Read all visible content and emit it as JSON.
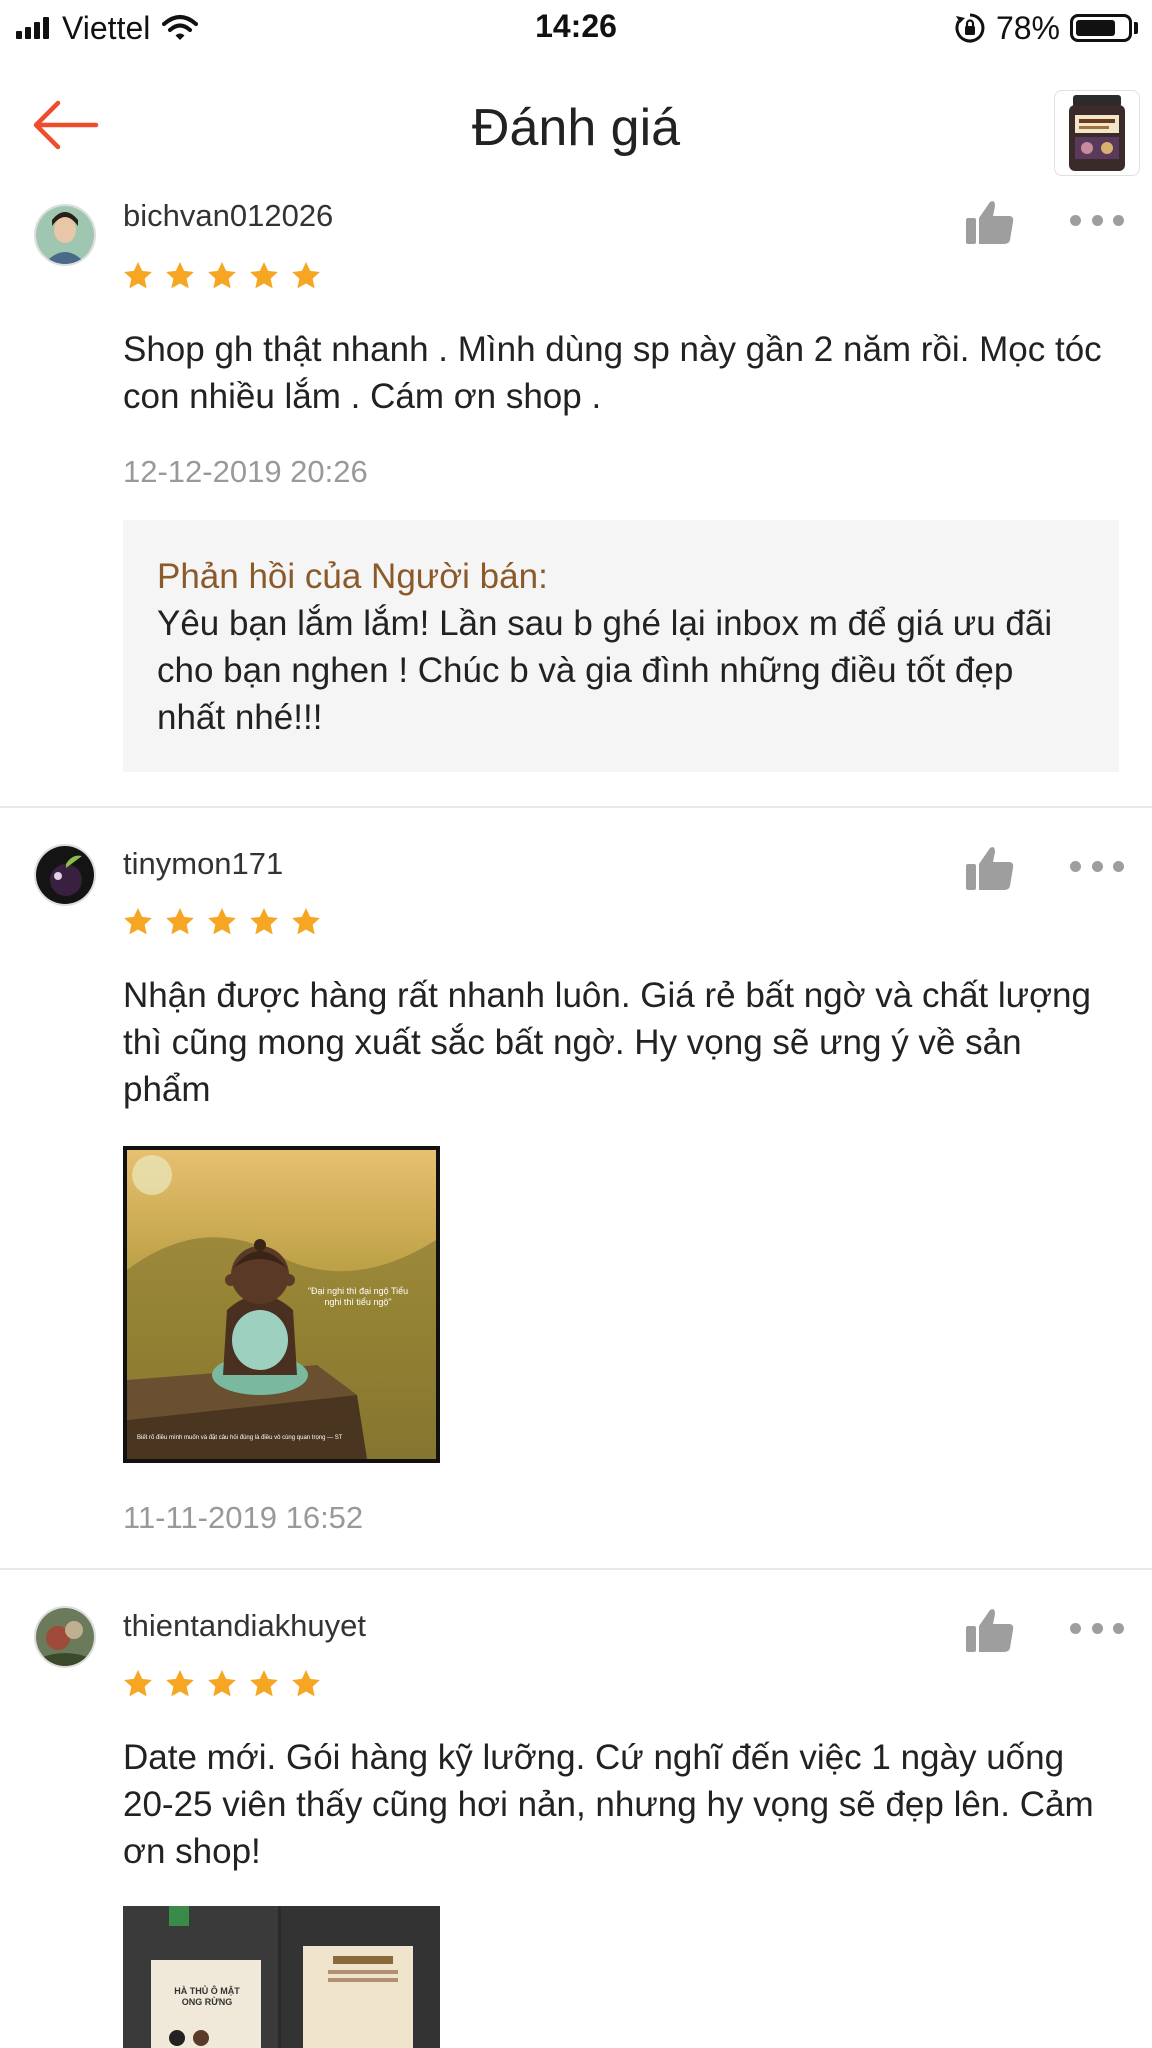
{
  "status_bar": {
    "carrier": "Viettel",
    "time": "14:26",
    "battery_percent": "78%",
    "battery_level": 0.78,
    "icons": [
      "signal-icon",
      "wifi-icon",
      "rotation-lock-icon",
      "battery-icon"
    ]
  },
  "header": {
    "back_icon": "arrow-left-icon",
    "title": "Đánh giá",
    "accent_color": "#ee4d2d"
  },
  "reviews": [
    {
      "username": "bichvan012026",
      "rating": 5,
      "text": "Shop gh thật nhanh . Mình dùng sp này gần 2 năm rồi. Mọc tóc con nhiều lắm . Cám ơn shop .",
      "date": "12-12-2019 20:26",
      "seller_reply": {
        "label": "Phản hồi của Người bán:",
        "text": "Yêu bạn lắm lắm! Lần sau b ghé lại inbox m để giá ưu đãi cho bạn nghen ! Chúc b và gia đình những điều tốt đẹp nhất nhé!!!"
      }
    },
    {
      "username": "tinymon171",
      "rating": 5,
      "text": "Nhận được hàng rất nhanh luôn. Giá rẻ bất ngờ và chất lượng thì cũng mong xuất sắc bất ngờ. Hy vọng sẽ ưng ý về sản phẩm",
      "image": {
        "quote": "\"Đại nghi thì đại ngộ Tiểu nghi thì tiểu ngộ\"",
        "caption": "Biết rõ điều mình muốn và đặt câu hỏi đúng là điều vô cùng quan trọng — ST"
      },
      "date": "11-11-2019 16:52"
    },
    {
      "username": "thientandiakhuyet",
      "rating": 5,
      "text": "Date mới. Gói hàng kỹ lưỡng. Cứ nghĩ đến việc 1 ngày uống 20-25 viên thấy cũng hơi nản, nhưng hy vọng sẽ đẹp lên. Cảm ơn shop!",
      "image": {
        "label": "HÀ THỦ Ô MẬT ONG RỪNG"
      }
    }
  ],
  "colors": {
    "star": "#f6a623",
    "seller_label": "#8b5a2b",
    "date": "#999999"
  }
}
